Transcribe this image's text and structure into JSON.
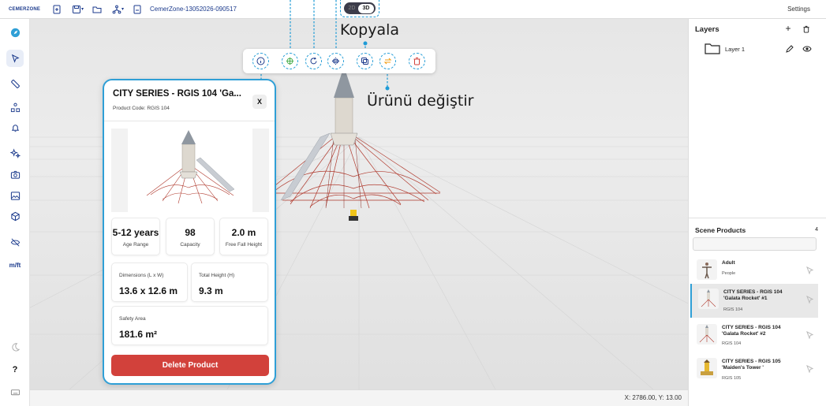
{
  "topbar": {
    "brand": "CEMERZONE",
    "file_name": "CemerZone-13052026-090517",
    "settings_label": "Settings"
  },
  "mode_toggle": {
    "option_2d": "2D",
    "option_3d": "3D",
    "selected": "3D"
  },
  "annotations": {
    "copy": "Kopyala",
    "change_product": "Ürünü değiştir"
  },
  "product_card": {
    "title": "CITY SERIES - RGIS 104 'Ga...",
    "code": "Product Code: RGIS 104",
    "close_label": "X",
    "stats": [
      {
        "value": "5-12 years",
        "label": "Age Range"
      },
      {
        "value": "98",
        "label": "Capacity"
      },
      {
        "value": "2.0 m",
        "label": "Free Fall Height"
      }
    ],
    "dimensions": {
      "label": "Dimensions (L x W)",
      "value": "13.6 x 12.6 m"
    },
    "total_height": {
      "label": "Total Height (H)",
      "value": "9.3 m"
    },
    "safety_area": {
      "label": "Safety Area",
      "value": "181.6 m²"
    },
    "delete_label": "Delete Product"
  },
  "layers": {
    "title": "Layers",
    "items": [
      {
        "name": "Layer 1"
      }
    ]
  },
  "scene_products": {
    "title": "Scene Products",
    "count": "4",
    "search_value": "",
    "items": [
      {
        "name": "Adult",
        "sub": "People",
        "active": false
      },
      {
        "name": "CITY SERIES - RGIS 104 'Galata Rocket' #1",
        "sub": "RGIS 104",
        "active": true
      },
      {
        "name": "CITY SERIES - RGIS 104 'Galata Rocket' #2",
        "sub": "RGIS 104",
        "active": false
      },
      {
        "name": "CITY SERIES - RGIS 105 'Maiden's Tower '",
        "sub": "RGIS 105",
        "active": false
      }
    ]
  },
  "status": {
    "coords": "X: 2786.00, Y: 13.00"
  },
  "left_toolbar": {
    "measure_label": "m/ft",
    "help_label": "?"
  },
  "colors": {
    "accent": "#2f9fd6",
    "brand": "#1b3a8c",
    "danger": "#d2413b"
  }
}
